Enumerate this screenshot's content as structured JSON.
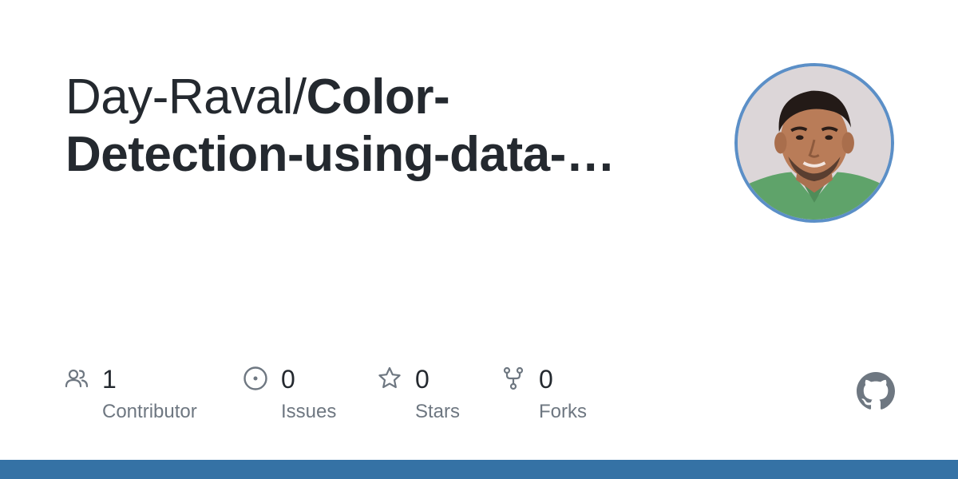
{
  "repo": {
    "owner": "Day-Raval/",
    "name_line1": "Color-",
    "name_line2": "Detection-using-data-…"
  },
  "avatar": {
    "icon": "user-avatar-photo",
    "ring_color": "#5b8fc7"
  },
  "stats": {
    "contributors": {
      "count": "1",
      "label": "Contributor",
      "icon": "people-icon"
    },
    "issues": {
      "count": "0",
      "label": "Issues",
      "icon": "issue-opened-icon"
    },
    "stars": {
      "count": "0",
      "label": "Stars",
      "icon": "star-icon"
    },
    "forks": {
      "count": "0",
      "label": "Forks",
      "icon": "repo-forked-icon"
    }
  },
  "brand": {
    "logo": "github-mark-icon",
    "logo_color": "#6e7781"
  },
  "colors": {
    "text_primary": "#24292f",
    "text_secondary": "#6e7781",
    "bottom_bar": "#3572a5"
  }
}
